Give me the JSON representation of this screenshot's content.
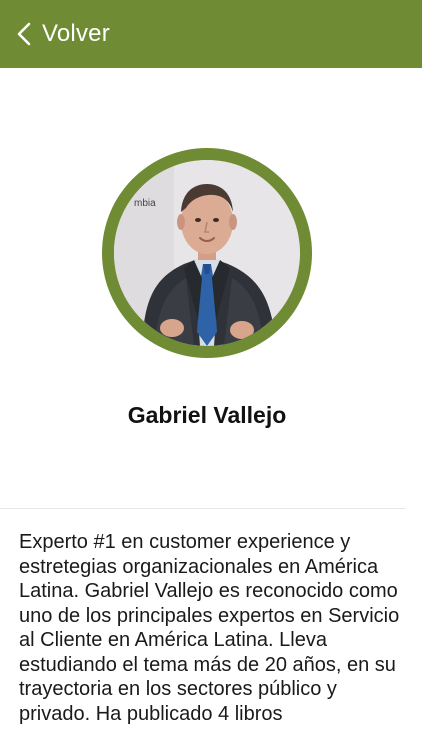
{
  "header": {
    "back_label": "Volver",
    "back_icon": "chevron-left-icon",
    "background_color": "#6f8b33"
  },
  "profile": {
    "photo_backdrop_text": "mbia",
    "name": "Gabriel Vallejo",
    "bio": "Experto #1 en customer experience y estretegias organizacionales en América Latina. Gabriel Vallejo es reconocido como uno de los principales expertos en Servicio al Cliente en América Latina. Lleva estudiando el tema más de 20 años, en su trayectoria en los sectores público y privado. Ha publicado 4 libros"
  }
}
